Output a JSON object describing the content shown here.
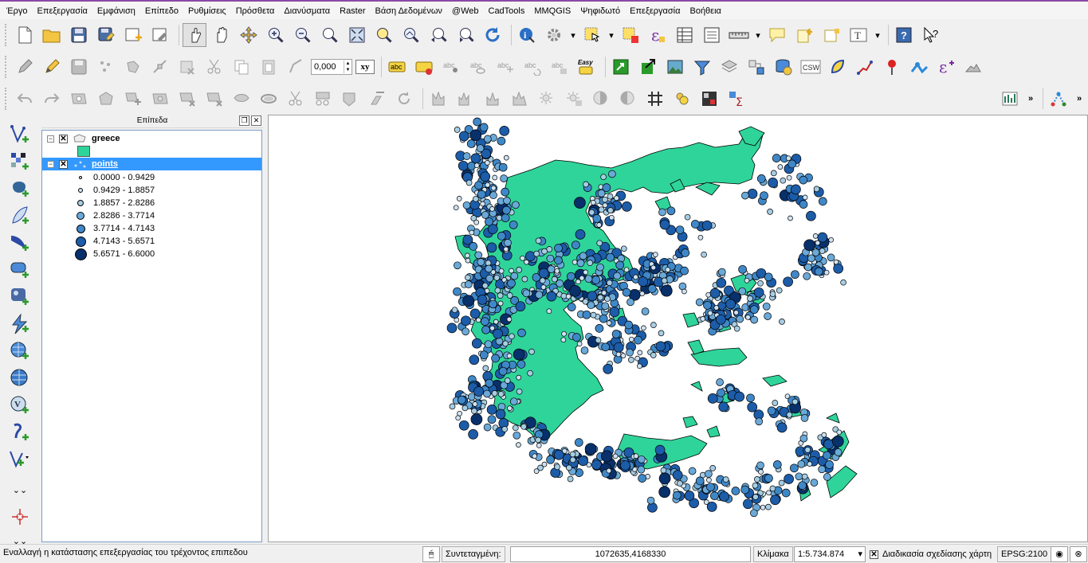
{
  "menu": [
    "Έργο",
    "Επεξεργασία",
    "Εμφάνιση",
    "Επίπεδο",
    "Ρυθμίσεις",
    "Πρόσθετα",
    "Διανύσματα",
    "Raster",
    "Βάση Δεδομένων",
    "@Web",
    "CadTools",
    "MMQGIS",
    "Ψηφιδωτό",
    "Επεξεργασία",
    "Βοήθεια"
  ],
  "toolbar2": {
    "scale_value": "0,000",
    "label_xy": "xy",
    "easy_label": "Easy",
    "csw_label": "CSW",
    "abc": "abc"
  },
  "overflow": "»",
  "layers_panel": {
    "title": "Επίπεδα",
    "layers": [
      {
        "name": "greece",
        "fill": "#2fd49a"
      },
      {
        "name": "points"
      }
    ],
    "legend": [
      {
        "label": "0.0000 - 0.9429",
        "size": 4,
        "color": "#f7fbff"
      },
      {
        "label": "0.9429 - 1.8857",
        "size": 6,
        "color": "#d0e3f3"
      },
      {
        "label": "1.8857 - 2.8286",
        "size": 8,
        "color": "#a6cde3"
      },
      {
        "label": "2.8286 - 3.7714",
        "size": 10,
        "color": "#6aa9d8"
      },
      {
        "label": "3.7714 - 4.7143",
        "size": 11,
        "color": "#3f88c8"
      },
      {
        "label": "4.7143 - 5.6571",
        "size": 13,
        "color": "#1c5ca8"
      },
      {
        "label": "5.6571 - 6.6000",
        "size": 15,
        "color": "#08306b"
      }
    ]
  },
  "statusbar": {
    "message": "Εναλλαγή η κατάστασης επεξεργασίας του τρέχοντος επιπεδου",
    "coord_label": "Συντεταγμένη:",
    "coord_value": "1072635,4168330",
    "scale_label": "Κλίμακα",
    "scale_value": "1:5.734.874",
    "render_label": "Διαδικασία σχεδίασης χάρτη",
    "render_checked": true,
    "crs": "EPSG:2100"
  },
  "colors": {
    "land": "#2fd49a",
    "point_mid": "#6aa9d8",
    "selection": "#3399ff"
  }
}
